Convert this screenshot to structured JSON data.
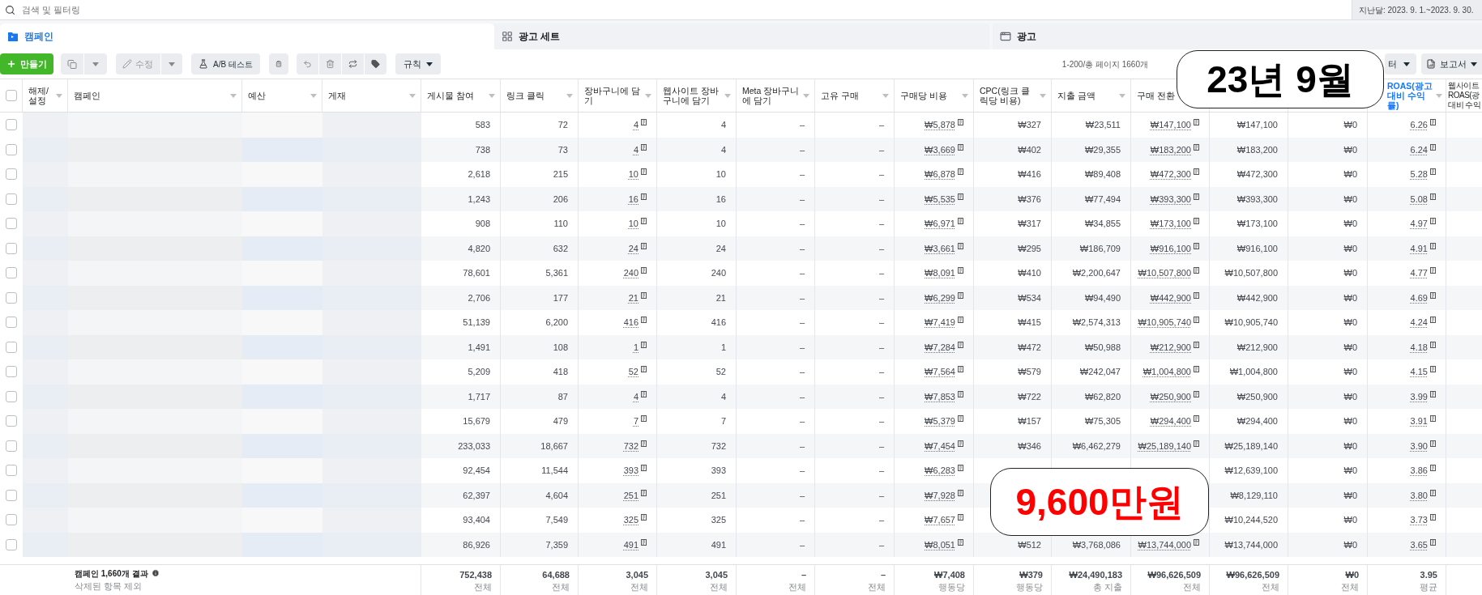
{
  "search": {
    "placeholder": "검색 및 필터링"
  },
  "date_range": {
    "label": "지난달: 2023. 9. 1.~2023. 9. 30."
  },
  "tabs": [
    {
      "label": "캠페인",
      "selected": true
    },
    {
      "label": "광고 세트",
      "selected": false
    },
    {
      "label": "광고",
      "selected": false
    }
  ],
  "toolbar": {
    "create": "만들기",
    "edit": "수정",
    "ab_test": "A/B 테스트",
    "rules": "규칙",
    "pagination": "1-200/총 페이지 1660개",
    "filter": "터",
    "report": "보고서"
  },
  "table": {
    "select_all": {
      "checked": false
    },
    "columns": [
      {
        "label": "해제/설정",
        "kind": "redacted",
        "sorted": false
      },
      {
        "label": "캠페인",
        "kind": "redacted",
        "sorted": false
      },
      {
        "label": "예산",
        "kind": "redacted",
        "sorted": false
      },
      {
        "label": "게재",
        "kind": "redacted",
        "sorted": false
      },
      {
        "label": "게시물 참여",
        "kind": "number",
        "sorted": false
      },
      {
        "label": "링크 클릭",
        "kind": "number",
        "sorted": false
      },
      {
        "label": "장바구니에 담기",
        "kind": "linked",
        "sorted": false
      },
      {
        "label": "웹사이트 장바구니에 담기",
        "kind": "number",
        "sorted": false
      },
      {
        "label": "Meta 장바구니에 담기",
        "kind": "number",
        "sorted": false
      },
      {
        "label": "고유 구매",
        "kind": "number",
        "sorted": false
      },
      {
        "label": "구매당 비용",
        "kind": "linked",
        "sorted": false
      },
      {
        "label": "CPC(링크 클릭당 비용)",
        "kind": "number",
        "sorted": false
      },
      {
        "label": "지출 금액",
        "kind": "number",
        "sorted": false
      },
      {
        "label": "구매 전환",
        "kind": "linked",
        "sorted": false
      },
      {
        "kind": "number",
        "sorted": false
      },
      {
        "kind": "number",
        "sorted": false
      },
      {
        "label": "ROAS(광고 대비 수익률)",
        "kind": "linked",
        "sorted": true
      },
      {
        "label": "웹사이트 ROAS(광 대비 수익",
        "kind": "empty",
        "sorted": false
      }
    ],
    "rows": [
      {
        "checked": false,
        "cells": [
          null,
          null,
          null,
          null,
          "583",
          "72",
          "4",
          "4",
          "–",
          "–",
          "₩5,878",
          "₩327",
          "₩23,511",
          "₩147,100",
          "₩147,100",
          "₩0",
          "6.26"
        ]
      },
      {
        "checked": false,
        "cells": [
          null,
          null,
          null,
          null,
          "738",
          "73",
          "4",
          "4",
          "–",
          "–",
          "₩3,669",
          "₩402",
          "₩29,355",
          "₩183,200",
          "₩183,200",
          "₩0",
          "6.24"
        ]
      },
      {
        "checked": false,
        "cells": [
          null,
          null,
          null,
          null,
          "2,618",
          "215",
          "10",
          "10",
          "–",
          "–",
          "₩6,878",
          "₩416",
          "₩89,408",
          "₩472,300",
          "₩472,300",
          "₩0",
          "5.28"
        ]
      },
      {
        "checked": false,
        "cells": [
          null,
          null,
          null,
          null,
          "1,243",
          "206",
          "16",
          "16",
          "–",
          "–",
          "₩5,535",
          "₩376",
          "₩77,494",
          "₩393,300",
          "₩393,300",
          "₩0",
          "5.08"
        ]
      },
      {
        "checked": false,
        "cells": [
          null,
          null,
          null,
          null,
          "908",
          "110",
          "10",
          "10",
          "–",
          "–",
          "₩6,971",
          "₩317",
          "₩34,855",
          "₩173,100",
          "₩173,100",
          "₩0",
          "4.97"
        ]
      },
      {
        "checked": false,
        "cells": [
          null,
          null,
          null,
          null,
          "4,820",
          "632",
          "24",
          "24",
          "–",
          "–",
          "₩3,661",
          "₩295",
          "₩186,709",
          "₩916,100",
          "₩916,100",
          "₩0",
          "4.91"
        ]
      },
      {
        "checked": false,
        "cells": [
          null,
          null,
          null,
          null,
          "78,601",
          "5,361",
          "240",
          "240",
          "–",
          "–",
          "₩8,091",
          "₩410",
          "₩2,200,647",
          "₩10,507,800",
          "₩10,507,800",
          "₩0",
          "4.77"
        ]
      },
      {
        "checked": false,
        "cells": [
          null,
          null,
          null,
          null,
          "2,706",
          "177",
          "21",
          "21",
          "–",
          "–",
          "₩6,299",
          "₩534",
          "₩94,490",
          "₩442,900",
          "₩442,900",
          "₩0",
          "4.69"
        ]
      },
      {
        "checked": false,
        "cells": [
          null,
          null,
          null,
          null,
          "51,139",
          "6,200",
          "416",
          "416",
          "–",
          "–",
          "₩7,419",
          "₩415",
          "₩2,574,313",
          "₩10,905,740",
          "₩10,905,740",
          "₩0",
          "4.24"
        ]
      },
      {
        "checked": false,
        "cells": [
          null,
          null,
          null,
          null,
          "1,491",
          "108",
          "1",
          "1",
          "–",
          "–",
          "₩7,284",
          "₩472",
          "₩50,988",
          "₩212,900",
          "₩212,900",
          "₩0",
          "4.18"
        ]
      },
      {
        "checked": false,
        "cells": [
          null,
          null,
          null,
          null,
          "5,209",
          "418",
          "52",
          "52",
          "–",
          "–",
          "₩7,564",
          "₩579",
          "₩242,047",
          "₩1,004,800",
          "₩1,004,800",
          "₩0",
          "4.15"
        ]
      },
      {
        "checked": false,
        "cells": [
          null,
          null,
          null,
          null,
          "1,717",
          "87",
          "4",
          "4",
          "–",
          "–",
          "₩7,853",
          "₩722",
          "₩62,820",
          "₩250,900",
          "₩250,900",
          "₩0",
          "3.99"
        ]
      },
      {
        "checked": false,
        "cells": [
          null,
          null,
          null,
          null,
          "15,679",
          "479",
          "7",
          "7",
          "–",
          "–",
          "₩5,379",
          "₩157",
          "₩75,305",
          "₩294,400",
          "₩294,400",
          "₩0",
          "3.91"
        ]
      },
      {
        "checked": false,
        "cells": [
          null,
          null,
          null,
          null,
          "233,033",
          "18,667",
          "732",
          "732",
          "–",
          "–",
          "₩7,454",
          "₩346",
          "₩6,462,279",
          "₩25,189,140",
          "₩25,189,140",
          "₩0",
          "3.90"
        ]
      },
      {
        "checked": false,
        "cells": [
          null,
          null,
          null,
          null,
          "92,454",
          "11,544",
          "393",
          "393",
          "–",
          "–",
          "₩6,283",
          null,
          null,
          null,
          "₩12,639,100",
          "₩0",
          "3.86"
        ]
      },
      {
        "checked": false,
        "cells": [
          null,
          null,
          null,
          null,
          "62,397",
          "4,604",
          "251",
          "251",
          "–",
          "–",
          "₩7,928",
          null,
          null,
          null,
          "₩8,129,110",
          "₩0",
          "3.80"
        ]
      },
      {
        "checked": false,
        "cells": [
          null,
          null,
          null,
          null,
          "93,404",
          "7,549",
          "325",
          "325",
          "–",
          "–",
          "₩7,657",
          null,
          null,
          null,
          "₩10,244,520",
          "₩0",
          "3.73"
        ]
      },
      {
        "checked": false,
        "cells": [
          null,
          null,
          null,
          null,
          "86,926",
          "7,359",
          "491",
          "491",
          "–",
          "–",
          "₩8,051",
          "₩512",
          "₩3,768,086",
          "₩13,744,000",
          "₩13,744,000",
          "₩0",
          "3.65"
        ]
      }
    ],
    "footer": {
      "summary": "캠페인 1,660개 결과",
      "note": "삭제된 항목 제외",
      "totals": [
        {
          "value": "752,438",
          "sub": "전체"
        },
        {
          "value": "64,688",
          "sub": "전체"
        },
        {
          "value": "3,045",
          "sub": "전체"
        },
        {
          "value": "3,045",
          "sub": "전체"
        },
        {
          "value": "–",
          "sub": "전체"
        },
        {
          "value": "–",
          "sub": "전체"
        },
        {
          "value": "₩7,408",
          "sub": "행동당"
        },
        {
          "value": "₩379",
          "sub": "행동당"
        },
        {
          "value": "₩24,490,183",
          "sub": "총 지출"
        },
        {
          "value": "₩96,626,509",
          "sub": "전체"
        },
        {
          "value": "₩96,626,509",
          "sub": "전체"
        },
        {
          "value": "₩0",
          "sub": "전체"
        },
        {
          "value": "3.95",
          "sub": "평균"
        }
      ]
    }
  },
  "callouts": [
    {
      "text": "23년 9월",
      "kind": "date"
    },
    {
      "text": "9,600만원",
      "kind": "amount"
    }
  ]
}
